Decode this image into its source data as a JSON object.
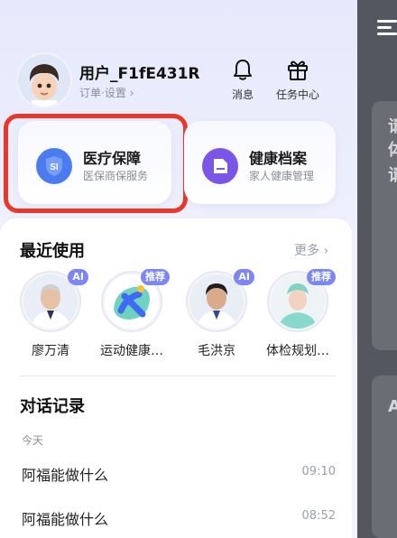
{
  "profile": {
    "name": "用户_F1fE431R",
    "links": "订单·设置 ›"
  },
  "header_buttons": [
    {
      "label": "消息",
      "icon": "bell-icon"
    },
    {
      "label": "任务中心",
      "icon": "gift-icon"
    }
  ],
  "feature_cards": [
    {
      "title": "医疗保障",
      "subtitle": "医保商保服务",
      "icon": "shield-icon",
      "icon_text": "SI",
      "color": "#4a7cf0",
      "highlighted": true
    },
    {
      "title": "健康档案",
      "subtitle": "家人健康管理",
      "icon": "folder-icon",
      "color": "#7a55e8"
    }
  ],
  "recent": {
    "title": "最近使用",
    "more_label": "更多 ›",
    "items": [
      {
        "label": "廖万清",
        "badge": "AI"
      },
      {
        "label": "运动健康…",
        "badge": "推荐"
      },
      {
        "label": "毛洪京",
        "badge": "AI"
      },
      {
        "label": "体检规划…",
        "badge": "推荐"
      }
    ]
  },
  "conversations": {
    "title": "对话记录",
    "groups": [
      {
        "date_label": "今天",
        "items": [
          {
            "title": "阿福能做什么",
            "time": "09:10"
          },
          {
            "title": "阿福能做什么",
            "time": "08:52"
          }
        ]
      }
    ]
  },
  "side_panel": {
    "texts": [
      "请",
      "体",
      "请",
      "A"
    ]
  },
  "colors": {
    "badge": "#7d86f5",
    "highlight_border": "#e8382c",
    "background": "#e6e9fb"
  }
}
